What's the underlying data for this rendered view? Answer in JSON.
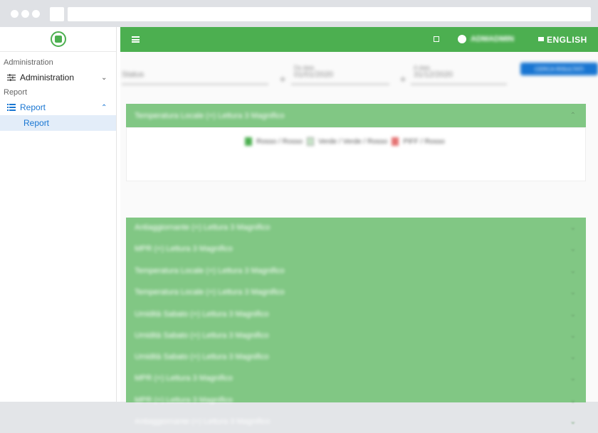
{
  "browser": {},
  "sidebar": {
    "section_admin": "Administration",
    "item_admin": "Administration",
    "section_report": "Report",
    "item_report": "Report",
    "sub_report": "Report"
  },
  "topbar": {
    "user_name": "ADMADMIN",
    "language": "ENGLISH"
  },
  "filters": {
    "field1": "Status",
    "field2_caption": "Da data",
    "field2": "01/01/2020",
    "field3_caption": "A data",
    "field3": "31/12/2020",
    "button": "CERCA RISULTATI"
  },
  "panel": {
    "title": "Temperatura Locale (+) Lettura 3 Magnifico",
    "legend": [
      "Rosso / Rosso",
      "Verde / Verde / Rosso",
      "PIFF / Rosso"
    ]
  },
  "rows": [
    "Antiaggiornante (+) Lettura 3 Magnifico",
    "MPR (+) Lettura 3 Magnifico",
    "Temperatura Locale (+) Lettura 3 Magnifico",
    "Temperatura Locale (+) Lettura 3 Magnifico",
    "Umidità Sabato (+) Lettura 3 Magnifico",
    "Umidità Sabato (+) Lettura 3 Magnifico",
    "Umidità Sabato (+) Lettura 3 Magnifico",
    "MPR (+) Lettura 3 Magnifico",
    "MPR (+) Lettura 3 Magnifico",
    "Antiaggiornante (+) Lettura 3 Magnifico"
  ],
  "colors": {
    "primary": "#4caf50",
    "panel": "#81c784",
    "accent": "#1976d2"
  }
}
